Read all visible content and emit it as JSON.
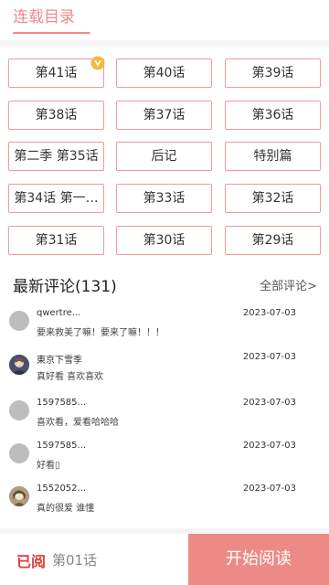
{
  "tab": {
    "title": "连载目录"
  },
  "chapters": [
    "第41话",
    "第40话",
    "第39话",
    "第38话",
    "第37话",
    "第36话",
    "第二季 第35话",
    "后记",
    "特别篇",
    "第34话 第一…",
    "第33话",
    "第32话",
    "第31话",
    "第30话",
    "第29话"
  ],
  "comments": {
    "title": "最新评论(131)",
    "all_label": "全部评论>",
    "items": [
      {
        "name": "qwertre...",
        "date": "2023-07-03",
        "text": "要来救美了嘛！要来了嘛！！！",
        "avatar": "default-avatar"
      },
      {
        "name": "東京下雪季",
        "date": "2023-07-03",
        "text": "真好看 喜欢喜欢",
        "avatar": "user-photo-avatar"
      },
      {
        "name": "1597585...",
        "date": "2023-07-03",
        "text": "喜欢看，爱看哈哈哈",
        "avatar": "default-avatar"
      },
      {
        "name": "1597585...",
        "date": "2023-07-03",
        "text": "好看▯",
        "avatar": "default-avatar"
      },
      {
        "name": "1552052...",
        "date": "2023-07-03",
        "text": "真的很爱 谁懂",
        "avatar": "user-photo-avatar"
      }
    ]
  },
  "bottom": {
    "read_label": "已阅",
    "read_chapter": "第01话",
    "start_label": "开始阅读"
  },
  "colors": {
    "accent": "#ee8a8a",
    "read_red": "#e53935",
    "button": "#ee8a86"
  }
}
